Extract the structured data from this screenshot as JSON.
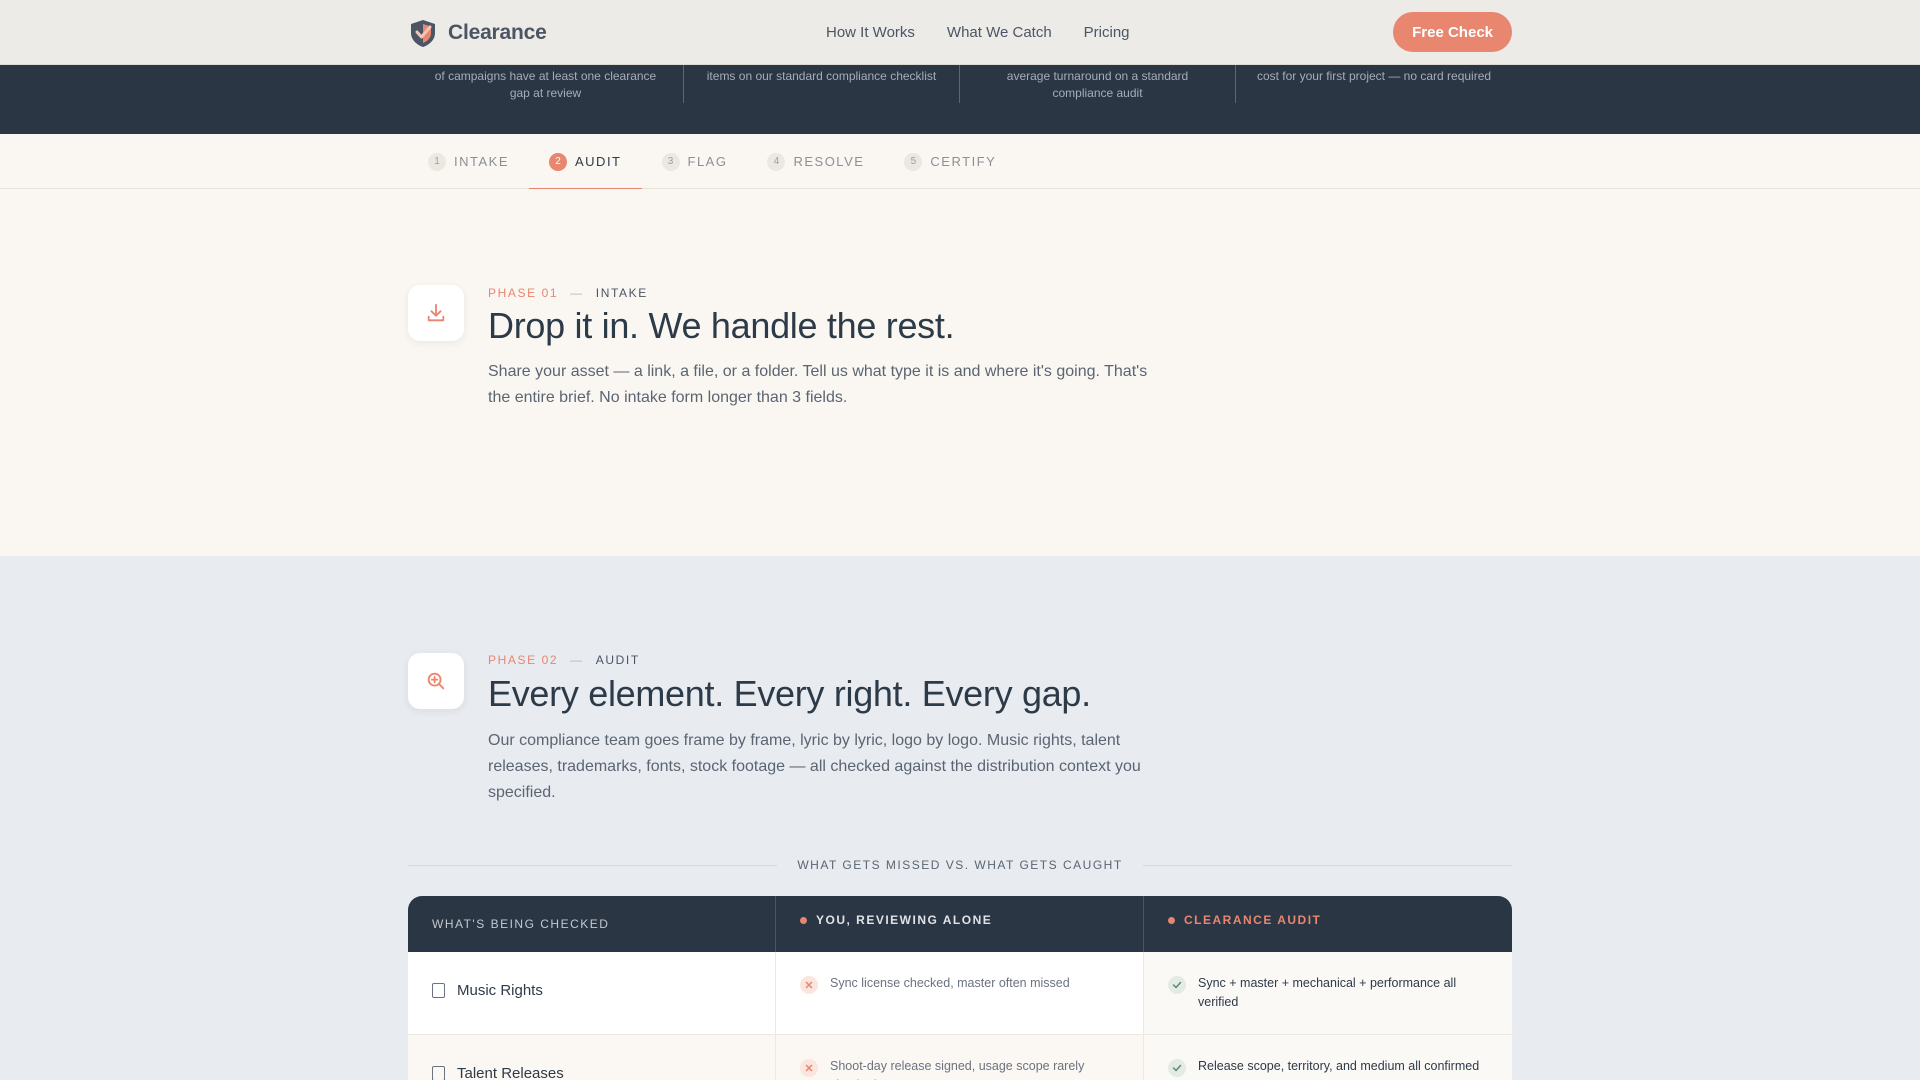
{
  "nav": {
    "brand": "Clearance",
    "links": [
      "How It Works",
      "What We Catch",
      "Pricing"
    ],
    "cta": "Free Check"
  },
  "stats": [
    "of campaigns have at least one clearance gap at review",
    "items on our standard compliance checklist",
    "average turnaround on a standard compliance audit",
    "cost for your first project — no card required"
  ],
  "tabs": [
    {
      "num": "1",
      "label": "INTAKE"
    },
    {
      "num": "2",
      "label": "AUDIT"
    },
    {
      "num": "3",
      "label": "FLAG"
    },
    {
      "num": "4",
      "label": "RESOLVE"
    },
    {
      "num": "5",
      "label": "CERTIFY"
    }
  ],
  "phase1": {
    "num": "PHASE 01",
    "dash": "—",
    "name": "INTAKE",
    "headline": "Drop it in. We handle the rest.",
    "desc": "Share your asset — a link, a file, or a folder. Tell us what type it is and where it's going. That's the entire brief. No intake form longer than 3 fields.",
    "icon": "download-icon"
  },
  "phase2": {
    "num": "PHASE 02",
    "dash": "—",
    "name": "AUDIT",
    "headline": "Every element. Every right. Every gap.",
    "desc": "Our compliance team goes frame by frame, lyric by lyric, logo by logo. Music rights, talent releases, trademarks, fonts, stock footage — all checked against the distribution context you specified.",
    "icon": "zoom-in-icon"
  },
  "compare": {
    "label": "WHAT GETS MISSED VS. WHAT GETS CAUGHT",
    "headers": [
      "WHAT'S BEING CHECKED",
      "YOU, REVIEWING ALONE",
      "CLEARANCE AUDIT"
    ],
    "rows": [
      {
        "item": "Music Rights",
        "you": "Sync license checked, master often missed",
        "clearance": "Sync + master + mechanical + performance all verified"
      },
      {
        "item": "Talent Releases",
        "you": "Shoot-day release signed, usage scope rarely checked",
        "clearance": "Release scope, territory, and medium all confirmed"
      }
    ]
  },
  "colors": {
    "accent": "#e8866f",
    "navy": "#2b3644",
    "cream": "#faf7f2",
    "slate": "#e8ebf0"
  }
}
